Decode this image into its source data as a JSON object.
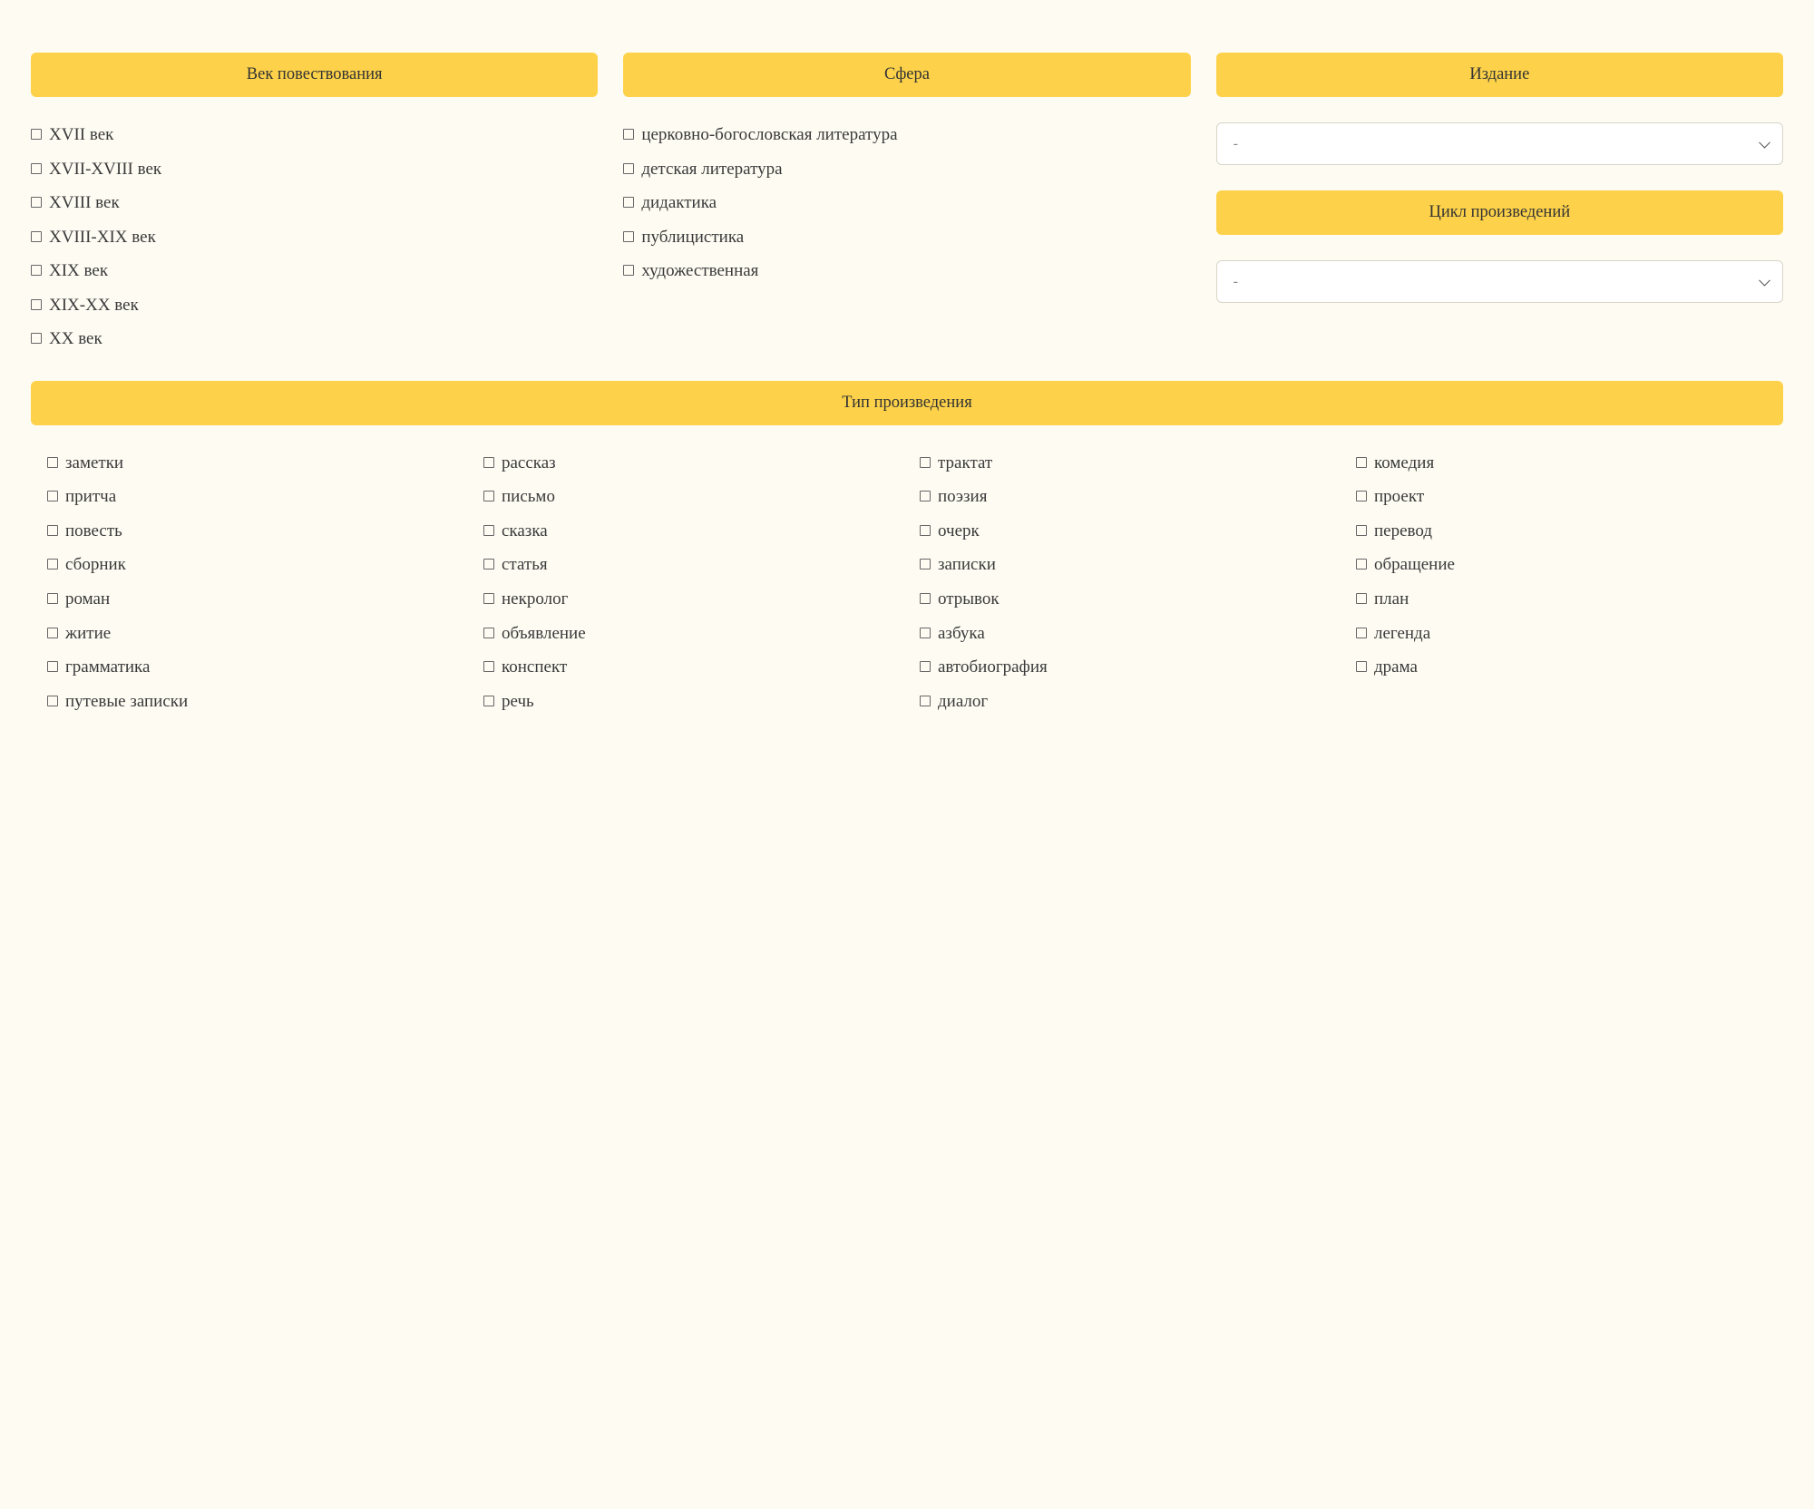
{
  "century": {
    "header": "Век повествования",
    "items": [
      "XVII век",
      "XVII-XVIII век",
      "XVIII век",
      "XVIII-XIX век",
      "XIX век",
      "XIX-XX век",
      "XX век"
    ]
  },
  "sphere": {
    "header": "Сфера",
    "items": [
      "церковно-богословская литература",
      "детская литература",
      "дидактика",
      "публицистика",
      "художественная"
    ]
  },
  "edition": {
    "header": "Издание",
    "selected": "-"
  },
  "cycle": {
    "header": "Цикл произведений",
    "selected": "-"
  },
  "work_type": {
    "header": "Тип произведения",
    "columns": [
      [
        "заметки",
        "притча",
        "повесть",
        "сборник",
        "роман",
        "житие",
        "грамматика",
        "путевые записки"
      ],
      [
        "рассказ",
        "письмо",
        "сказка",
        "статья",
        "некролог",
        "объявление",
        "конспект",
        "речь"
      ],
      [
        "трактат",
        "поэзия",
        "очерк",
        "записки",
        "отрывок",
        "азбука",
        "автобиография",
        "диалог"
      ],
      [
        "комедия",
        "проект",
        "перевод",
        "обращение",
        "план",
        "легенда",
        "драма"
      ]
    ]
  }
}
